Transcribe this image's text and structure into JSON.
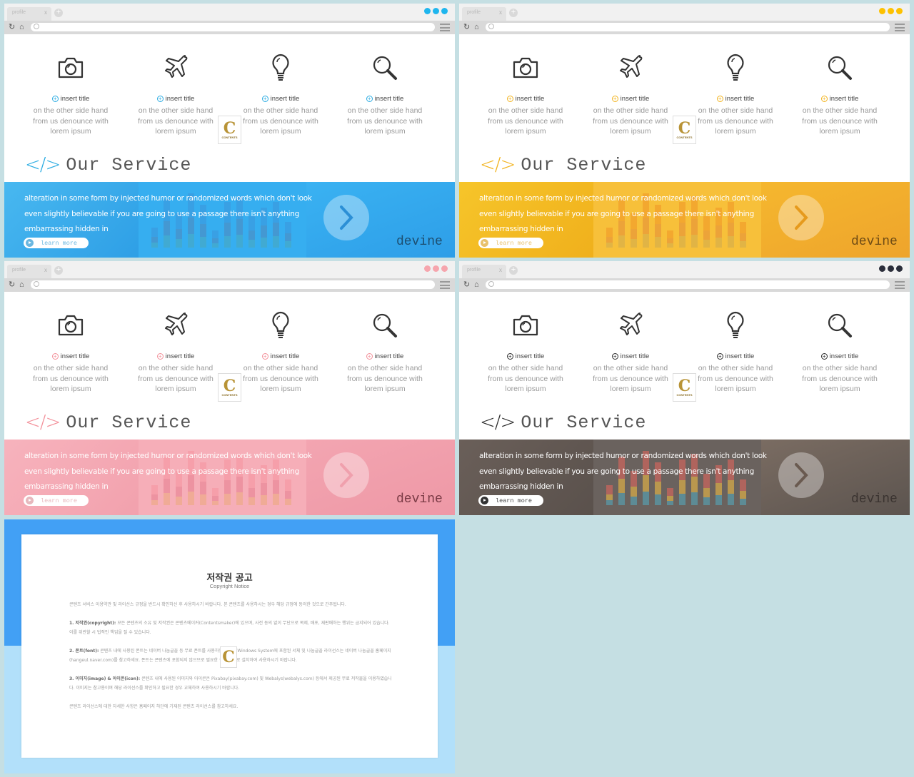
{
  "browser": {
    "tab_label": "profile",
    "tab_close": "x",
    "new_tab": "+"
  },
  "slides": [
    {
      "theme": "blue",
      "accent": "#29abe2",
      "dot_color": "#1fb6ee",
      "banner_color": "#2ba8ee",
      "learn_color": "#6ab7e0"
    },
    {
      "theme": "yellow",
      "accent": "#f2b31c",
      "dot_color": "#fdc100",
      "banner_color": "#f6b81e",
      "learn_color": "#e8c16c"
    },
    {
      "theme": "pink",
      "accent": "#f3909a",
      "dot_color": "#f6a5ad",
      "banner_color": "#f5a2ae",
      "learn_color": "#e7b8bd"
    },
    {
      "theme": "dark",
      "accent": "#2c2c2c",
      "dot_color": "#2b2e3b",
      "banner_color": "#5e5552",
      "learn_color": "#444444"
    }
  ],
  "services": [
    {
      "icon": "camera-icon",
      "title": "insert title",
      "desc": [
        "on the other side hand",
        "from us denounce with",
        "lorem ipsum"
      ]
    },
    {
      "icon": "airplane-icon",
      "title": "insert title",
      "desc": [
        "on the other side hand",
        "from us denounce with",
        "lorem ipsum"
      ]
    },
    {
      "icon": "lightbulb-icon",
      "title": "insert title",
      "desc": [
        "on the other side hand",
        "from us denounce with",
        "lorem ipsum"
      ]
    },
    {
      "icon": "search-icon",
      "title": "insert title",
      "desc": [
        "on the other side hand",
        "from us denounce with",
        "lorem ipsum"
      ]
    }
  ],
  "logo": {
    "letter": "C",
    "text": "CONTENTS"
  },
  "heading": {
    "code_icon": "</>",
    "title": "Our Service"
  },
  "banner": {
    "lines": [
      "alteration in some form by injected humor or randomized words which don't look",
      "even slightly believable if you are going to use a passage there isn't anything",
      "embarrassing hidden in"
    ],
    "learn_more": "learn more",
    "brand_word": "devine"
  },
  "copyright": {
    "title": "저작권 공고",
    "subtitle": "Copyright Notice",
    "intro": "콘텐츠 서비스 이용약관 및 라이선스 규정을 반드시 확인하신 후 사용하시기 바랍니다. 본 콘텐츠를 사용하시는 경우 해당 규정에 동의한 것으로 간주됩니다.",
    "sections": [
      {
        "label": "1. 저작권(copyright):",
        "text": "모든 콘텐츠의 소유 및 저작권은 콘텐츠메이커(Contentsmaker)에 있으며, 사전 동의 없이 무단으로 복제, 배포, 재판매하는 행위는 금지되어 있습니다. 이를 위반할 시 법적인 책임을 질 수 있습니다."
      },
      {
        "label": "2. 폰트(font):",
        "text": "콘텐츠 내에 사용된 폰트는 네이버 나눔글꼴 등 무료 폰트를 사용하였습니다. Windows System에 포함된 서체 및 나눔글꼴 라이선스는 네이버 나눔글꼴 홈페이지(hangeul.naver.com)를 참고하세요. 폰트는 콘텐츠에 포함되지 않으므로 필요한 경우 별도로 설치하여 사용하시기 바랍니다."
      },
      {
        "label": "3. 이미지(image) & 아이콘(icon):",
        "text": "콘텐츠 내에 사용된 이미지와 아이콘은 Pixabay(pixabay.com) 및 Webalys(webalys.com) 등에서 제공된 무료 저작물을 이용하였습니다. 이미지는 참고용이며 해당 라이선스를 확인하고 필요한 경우 교체하여 사용하시기 바랍니다."
      }
    ],
    "outro": "콘텐츠 라이선스에 대한 자세한 사항은 홈페이지 하단에 기재된 콘텐츠 라이선스를 참고하세요."
  }
}
